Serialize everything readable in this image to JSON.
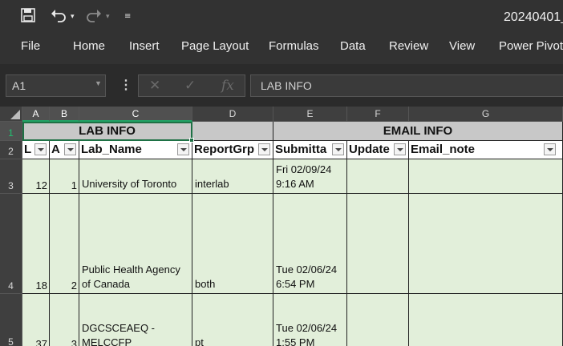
{
  "app": {
    "title": "20240401_"
  },
  "qat": {
    "save_icon": "save-icon",
    "undo_icon": "undo-icon",
    "redo_icon": "redo-icon",
    "customize_icon": "customize-qat-icon"
  },
  "ribbon": {
    "tabs": [
      "File",
      "Home",
      "Insert",
      "Page Layout",
      "Formulas",
      "Data",
      "Review",
      "View",
      "Power Pivot"
    ]
  },
  "formula_bar": {
    "name_box": "A1",
    "content": "LAB INFO",
    "fx": "fx"
  },
  "columns": [
    "A",
    "B",
    "C",
    "D",
    "E",
    "F",
    "G"
  ],
  "rows": [
    "1",
    "2",
    "3",
    "4",
    "5"
  ],
  "groups": {
    "lab_info": "LAB INFO",
    "email_info": "EMAIL INFO"
  },
  "headers": [
    "L",
    "A",
    "Lab_Name",
    "ReportGrp",
    "Submitta",
    "Update",
    "Email_note"
  ],
  "data": [
    {
      "a": "12",
      "b": "1",
      "lab_name": "University of Toronto",
      "report_grp": "interlab",
      "submitted_line1": "Fri 02/09/24",
      "submitted_line2": "9:16 AM"
    },
    {
      "a": "18",
      "b": "2",
      "lab_name": "Public Health Agency of Canada",
      "report_grp": "both",
      "submitted_line1": "Tue 02/06/24",
      "submitted_line2": "6:54 PM"
    },
    {
      "a": "37",
      "b": "3",
      "lab_name": "DGCSCEAEQ - MELCCFP",
      "report_grp": "pt",
      "submitted_line1": "Tue 02/06/24",
      "submitted_line2": "1:55 PM"
    }
  ],
  "colors": {
    "group_header": "#c8c8c8",
    "data_fill": "#e2efda",
    "selection": "#1e7145"
  }
}
